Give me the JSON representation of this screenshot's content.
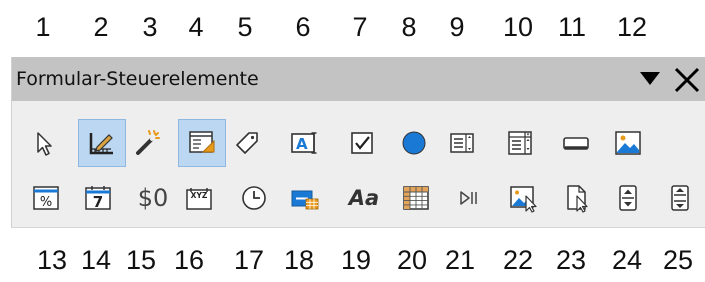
{
  "callouts": {
    "top": [
      "1",
      "2",
      "3",
      "4",
      "5",
      "6",
      "7",
      "8",
      "9",
      "10",
      "11",
      "12"
    ],
    "bottom": [
      "13",
      "14",
      "15",
      "16",
      "17",
      "18",
      "19",
      "20",
      "21",
      "22",
      "23",
      "24",
      "25"
    ]
  },
  "toolbar": {
    "title": "Formular-Steuerelemente",
    "currency_field_label": "$0",
    "formatting_label": "Aa",
    "pattern_field_label": "XYZ",
    "date_field_label": "7"
  },
  "colors": {
    "accent": "#1b79d6",
    "active_background": "#bcd7f2",
    "titlebar": "#c3c3c3",
    "panel": "#eeeeee"
  }
}
